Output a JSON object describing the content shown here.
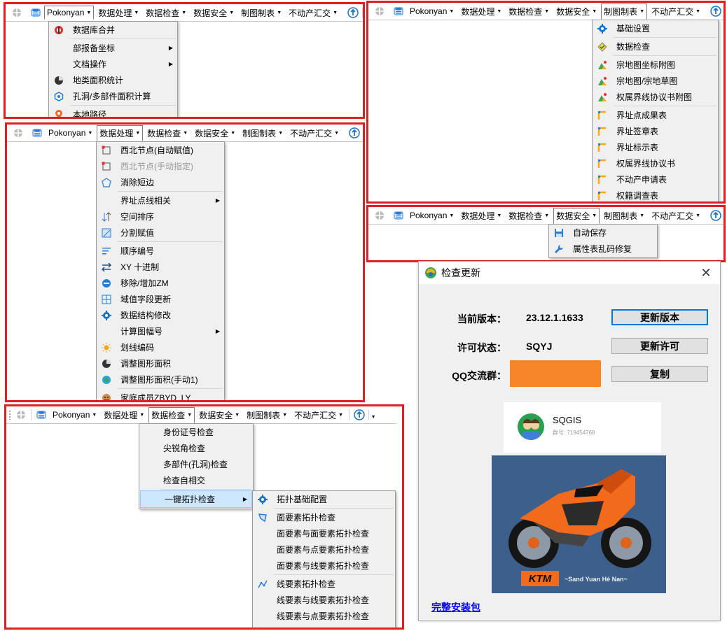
{
  "toolbar": {
    "pokonyan": "Pokonyan",
    "menus": [
      "数据处理",
      "数据检查",
      "数据安全",
      "制图制表",
      "不动产汇交"
    ]
  },
  "panel1": {
    "items": [
      {
        "label": "数据库合并",
        "icon": "merge-icon"
      },
      {
        "label": "部报备坐标",
        "submenu": true
      },
      {
        "label": "文档操作",
        "submenu": true
      },
      {
        "label": "地类面积统计",
        "icon": "pie-chart-icon"
      },
      {
        "label": "孔洞/多部件面积计算",
        "icon": "hexagon-icon"
      },
      {
        "label": "本地路径",
        "icon": "location-pin-icon"
      }
    ]
  },
  "panel2": {
    "items": [
      {
        "label": "基础设置",
        "icon": "gear-icon"
      },
      {
        "label": "数据检查",
        "icon": "check-diamond-icon"
      },
      {
        "label": "宗地图坐标附图",
        "icon": "mountain-icon"
      },
      {
        "label": "宗地图/宗地草图",
        "icon": "mountain-icon"
      },
      {
        "label": "权属界线协议书附图",
        "icon": "mountain-icon"
      },
      {
        "label": "界址点成果表",
        "icon": "corner-icon"
      },
      {
        "label": "界址签章表",
        "icon": "corner-icon"
      },
      {
        "label": "界址标示表",
        "icon": "corner-icon"
      },
      {
        "label": "权属界线协议书",
        "icon": "corner-icon"
      },
      {
        "label": "不动产申请表",
        "icon": "corner-icon"
      },
      {
        "label": "权籍调查表",
        "icon": "corner-icon"
      }
    ]
  },
  "panel3": {
    "items": [
      {
        "label": "西北节点(自动赋值)",
        "icon": "nw-node-icon"
      },
      {
        "label": "西北节点(手动指定)",
        "icon": "nw-node-icon",
        "disabled": true
      },
      {
        "label": "消除短边",
        "icon": "shape-icon"
      },
      {
        "label": "界址点线相关",
        "submenu": true
      },
      {
        "label": "空间排序",
        "icon": "sort-icon"
      },
      {
        "label": "分割赋值",
        "icon": "split-icon"
      },
      {
        "label": "顺序编号",
        "icon": "list-icon"
      },
      {
        "label": "XY 十进制",
        "icon": "swap-icon"
      },
      {
        "label": "移除/增加ZM",
        "icon": "zm-icon"
      },
      {
        "label": "域值字段更新",
        "icon": "field-icon"
      },
      {
        "label": "数据结构修改",
        "icon": "gear-icon"
      },
      {
        "label": "计算图幅号",
        "submenu": true
      },
      {
        "label": "划线编码",
        "icon": "sun-icon"
      },
      {
        "label": "调整图形面积",
        "icon": "pie-chart-icon"
      },
      {
        "label": "调整图形面积(手动1)",
        "icon": "globe-icon"
      },
      {
        "label": "家庭成员ZBYD_LY",
        "icon": "family-icon"
      }
    ]
  },
  "panel4": {
    "items": [
      {
        "label": "自动保存",
        "icon": "save-icon"
      },
      {
        "label": "属性表乱码修复",
        "icon": "wrench-icon"
      }
    ]
  },
  "panel5": {
    "items": [
      {
        "label": "身份证号检查"
      },
      {
        "label": "尖锐角检查"
      },
      {
        "label": "多部件(孔洞)检查"
      },
      {
        "label": "检查自相交"
      },
      {
        "label": "一键拓扑检查",
        "submenu": true
      }
    ],
    "subitems": [
      {
        "label": "拓扑基础配置",
        "icon": "gear-icon"
      },
      {
        "label": "面要素拓扑检查",
        "icon": "polygon-icon"
      },
      {
        "label": "面要素与面要素拓扑检查"
      },
      {
        "label": "面要素与点要素拓扑检查"
      },
      {
        "label": "面要素与线要素拓扑检查"
      },
      {
        "label": "线要素拓扑检查",
        "icon": "polyline-icon"
      },
      {
        "label": "线要素与线要素拓扑检查"
      },
      {
        "label": "线要素与点要素拓扑检查"
      }
    ]
  },
  "dialog": {
    "title": "检查更新",
    "version_label": "当前版本：",
    "version_value": "23.12.1.1633",
    "update_button": "更新版本",
    "license_label": "许可状态：",
    "license_value": "SQYJ",
    "renew_button": "更新许可",
    "qq_label": "QQ交流群：",
    "copy_button": "复制",
    "card_name": "SQGIS",
    "card_sub": "群号: 719454768",
    "bike_text": "~Sand Yuan Hé Nan~",
    "full_package_link": "完整安装包",
    "colors": {
      "orange": "#f7862b",
      "bike_bg": "#3d5f8b",
      "accent": "#0078d7"
    }
  }
}
